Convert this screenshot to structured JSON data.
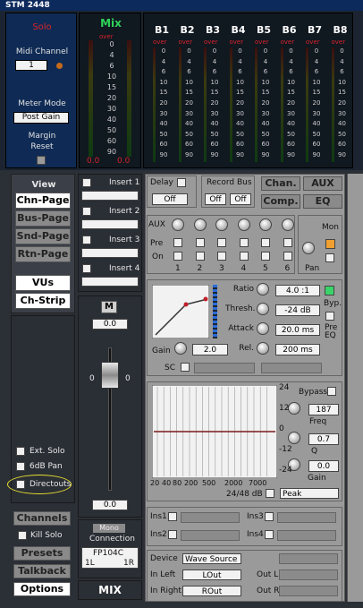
{
  "window": {
    "title": "STM 2448"
  },
  "top": {
    "solo": "Solo",
    "midi_channel_label": "Midi Channel",
    "midi_channel_value": "1",
    "meter_mode_label": "Meter Mode",
    "meter_mode_value": "Post Gain",
    "margin_label": "Margin",
    "reset_label": "Reset",
    "mix_label": "Mix",
    "mix_values": [
      "0.0",
      "0.0"
    ],
    "over_label": "over",
    "scale": [
      "0",
      "4",
      "6",
      "10",
      "15",
      "20",
      "30",
      "40",
      "50",
      "60",
      "90"
    ],
    "buses": [
      "B1",
      "B2",
      "B3",
      "B4",
      "B5",
      "B6",
      "B7",
      "B8"
    ]
  },
  "left": {
    "view_label": "View",
    "view_buttons": [
      "Chn-Page",
      "Bus-Page",
      "Snd-Page",
      "Rtn-Page",
      "VUs",
      "Ch-Strip"
    ],
    "ext_solo": "Ext. Solo",
    "pan_6db": "6dB Pan",
    "directouts": "Directouts",
    "channels": "Channels",
    "kill_solo": "Kill Solo",
    "presets": "Presets",
    "talkback": "Talkback",
    "options": "Options"
  },
  "strip": {
    "inserts": [
      "Insert 1",
      "Insert 2",
      "Insert 3",
      "Insert 4"
    ],
    "mute": "M",
    "fader_top": "0.0",
    "fader_bottom": "0.0",
    "fader_zero": "0",
    "mono": "Mono",
    "connection": "Connection",
    "conn_name": "FP104C",
    "conn_left": "1L",
    "conn_right": "1R",
    "mix": "MIX"
  },
  "right": {
    "delay_label": "Delay",
    "delay_value": "Off",
    "record_bus_label": "Record Bus",
    "record_bus_values": [
      "Off",
      "Off"
    ],
    "chan_btn": "Chan.",
    "aux_btn": "AUX",
    "comp_btn": "Comp.",
    "eq_btn": "EQ",
    "aux_label": "AUX",
    "pre_label": "Pre",
    "on_label": "On",
    "mon_label": "Mon",
    "pan_label": "Pan",
    "aux_numbers": [
      "1",
      "2",
      "3",
      "4",
      "5",
      "6"
    ],
    "comp": {
      "ratio_label": "Ratio",
      "ratio_value": "4.0 :1",
      "thresh_label": "Thresh.",
      "thresh_value": "-24 dB",
      "attack_label": "Attack",
      "attack_value": "20.0 ms",
      "rel_label": "Rel.",
      "rel_value": "200 ms",
      "gain_label": "Gain",
      "gain_value": "2.0",
      "byp_label": "Byp.",
      "pre_eq_label": "Pre EQ",
      "sc_label": "SC"
    },
    "eq": {
      "bypass_label": "Bypass",
      "db_ticks": [
        "24",
        "12",
        "0",
        "-12",
        "-24"
      ],
      "freq_value": "187",
      "freq_label": "Freq",
      "q_value": "0.7",
      "q_label": "Q",
      "gain_value": "0.0",
      "gain_label": "Gain",
      "freq_ticks": [
        "20",
        "40",
        "80",
        "200",
        "500",
        "2000",
        "7000"
      ],
      "range_label": "24/48 dB",
      "type_value": "Peak"
    },
    "ins": [
      "Ins1",
      "Ins2",
      "Ins3",
      "Ins4"
    ],
    "device_label": "Device",
    "device_value": "Wave Source",
    "in_left_label": "In Left",
    "in_left_value": "LOut",
    "in_right_label": "In Right",
    "in_right_value": "ROut",
    "out_l_label": "Out L",
    "out_r_label": "Out R"
  }
}
